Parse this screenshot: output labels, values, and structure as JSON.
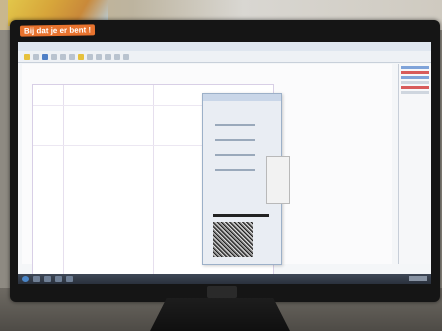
{
  "sticker": {
    "text": "Bij dat je er bent !"
  },
  "colors": {
    "accent": "#e8732e",
    "taskbar": "#2f3745",
    "selection": "#4f7fc6"
  },
  "icons": [
    "start-icon",
    "toolbar-icon",
    "monitor-logo"
  ]
}
